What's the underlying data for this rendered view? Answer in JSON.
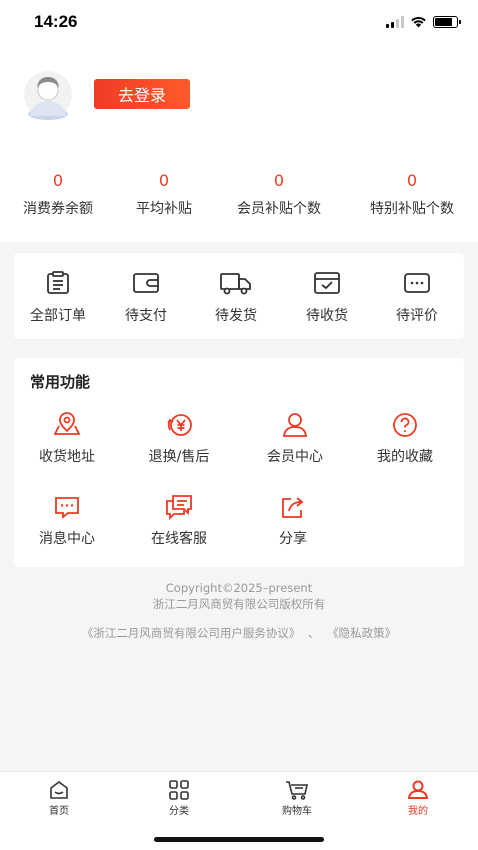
{
  "status_bar": {
    "time": "14:26"
  },
  "profile": {
    "login_label": "去登录"
  },
  "stats": [
    {
      "value": "0",
      "label": "消费券余额"
    },
    {
      "value": "0",
      "label": "平均补贴"
    },
    {
      "value": "0",
      "label": "会员补贴个数"
    },
    {
      "value": "0",
      "label": "特别补贴个数"
    }
  ],
  "orders": [
    {
      "label": "全部订单",
      "icon": "clipboard-icon"
    },
    {
      "label": "待支付",
      "icon": "wallet-icon"
    },
    {
      "label": "待发货",
      "icon": "truck-icon"
    },
    {
      "label": "待收货",
      "icon": "box-check-icon"
    },
    {
      "label": "待评价",
      "icon": "chat-dots-icon"
    }
  ],
  "functions": {
    "title": "常用功能",
    "items": [
      {
        "label": "收货地址",
        "icon": "map-pin-icon"
      },
      {
        "label": "退换/售后",
        "icon": "refund-icon"
      },
      {
        "label": "会员中心",
        "icon": "user-icon"
      },
      {
        "label": "我的收藏",
        "icon": "help-circle-icon"
      },
      {
        "label": "消息中心",
        "icon": "message-icon"
      },
      {
        "label": "在线客服",
        "icon": "service-chat-icon"
      },
      {
        "label": "分享",
        "icon": "share-icon"
      }
    ]
  },
  "footer": {
    "copyright_line1": "Copyright©2025–present",
    "copyright_line2": "浙江二月风商贸有限公司版权所有",
    "agreement_link": "《浙江二月风商贸有限公司用户服务协议》",
    "separator": "、",
    "privacy_link": "《隐私政策》"
  },
  "tabbar": [
    {
      "label": "首页",
      "icon": "home-icon"
    },
    {
      "label": "分类",
      "icon": "grid-icon"
    },
    {
      "label": "购物车",
      "icon": "cart-icon"
    },
    {
      "label": "我的",
      "icon": "profile-icon",
      "active": true
    }
  ],
  "colors": {
    "accent": "#ee3a24",
    "background": "#f5f5f5"
  }
}
